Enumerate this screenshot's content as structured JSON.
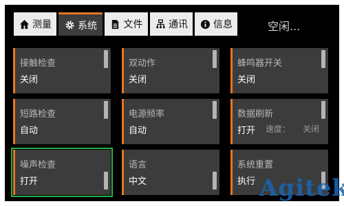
{
  "tabs": [
    {
      "label": "测量",
      "icon": "home-icon",
      "active": false
    },
    {
      "label": "系统",
      "icon": "gear-icon",
      "active": true
    },
    {
      "label": "文件",
      "icon": "document-icon",
      "active": false
    },
    {
      "label": "通讯",
      "icon": "network-icon",
      "active": false
    },
    {
      "label": "信息",
      "icon": "info-icon",
      "active": false
    }
  ],
  "status": "空闲...",
  "cards": [
    {
      "title": "接触检查",
      "value": "关闭"
    },
    {
      "title": "双动作",
      "value": "关闭"
    },
    {
      "title": "蜂鸣器开关",
      "value": "关闭"
    },
    {
      "title": "短路检查",
      "value": "自动"
    },
    {
      "title": "电源频率",
      "value": "自动"
    },
    {
      "title": "数据刷新",
      "value": "打开",
      "speed_label": "速度：",
      "off_label": "关闭"
    },
    {
      "title": "噪声检查",
      "value": "打开",
      "selected": true
    },
    {
      "title": "语言",
      "value": "中文"
    },
    {
      "title": "系统重置",
      "value": "执行"
    }
  ],
  "watermark": "Agitek",
  "colors": {
    "accent": "#e87722",
    "selection": "#27b14a",
    "watermark": "#1b64b0"
  }
}
